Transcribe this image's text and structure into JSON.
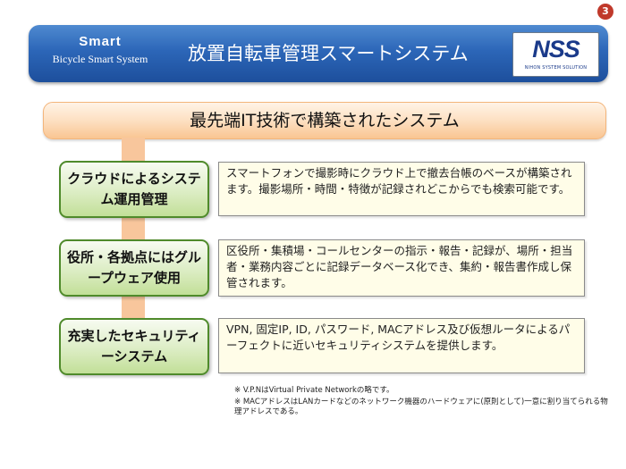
{
  "page_number": "3",
  "header": {
    "brand_name": "Smart",
    "brand_subtitle": "Bicycle Smart System",
    "title": "放置自転車管理スマートシステム",
    "logo": {
      "mark": "NSS",
      "subtitle": "NIHON SYSTEM SOLUTION"
    }
  },
  "banner": {
    "title": "最先端IT技術で構築されたシステム"
  },
  "features": [
    {
      "label": "クラウドによるシステム運用管理",
      "description": "スマートフォンで撮影時にクラウド上で撤去台帳のベースが構築されます。撮影場所・時間・特徴が記録されどこからでも検索可能です。"
    },
    {
      "label": "役所・各拠点にはグループウェア使用",
      "description": "区役所・集積場・コールセンターの指示・報告・記録が、場所・担当者・業務内容ごとに記録データベース化でき、集約・報告書作成し保管されます。"
    },
    {
      "label": "充実したセキュリティーシステム",
      "description": "VPN, 固定IP, ID, パスワード, MACアドレス及び仮想ルータによるパーフェクトに近いセキュリティシステムを提供します。"
    }
  ],
  "notes": [
    "※ V.P.NはVirtual Private Networkの略です。",
    "※ MACアドレスはLANカードなどのネットワーク機器のハードウェアに(原則として)一意に割り当てられる物理アドレスである。"
  ],
  "colors": {
    "header_blue": "#2c66b8",
    "banner_orange": "#f9c592",
    "feature_green": "#c2df98",
    "feature_border": "#4f8a2b",
    "desc_bg": "#fffde8",
    "page_badge": "#c0392b"
  }
}
